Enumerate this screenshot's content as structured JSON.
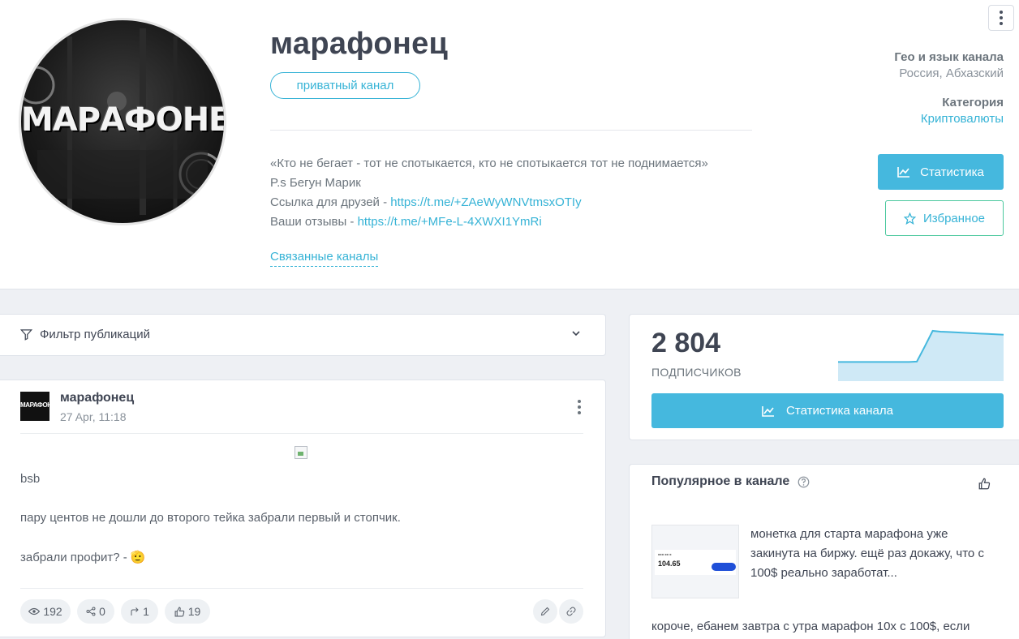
{
  "channel": {
    "title": "марафонец",
    "avatar_text": "МАРАФОНЕЦ",
    "tag": "приватный канал",
    "description": {
      "quote": "«Кто не бегает - тот не спотыкается, кто не спотыкается тот не поднимается»",
      "ps": "P.s Бегун Марик",
      "friends_label": "Ссылка для друзей - ",
      "friends_link": "https://t.me/+ZAeWyWNVtmsxOTIy",
      "reviews_label": "Ваши отзывы - ",
      "reviews_link": "https://t.me/+MFe-L-4XWXI1YmRi"
    },
    "related_link": "Связанные каналы",
    "geo_label": "Гео и язык канала",
    "geo_value": "Россия, Абхазский",
    "category_label": "Категория",
    "category_value": "Криптовалюты",
    "stats_button": "Статистика",
    "favorite_button": "Избранное"
  },
  "filter": {
    "label": "Фильтр публикаций"
  },
  "post": {
    "author": "марафонец",
    "avatar_text": "МАРАФОНЕЦ",
    "date": "27 Apr, 11:18",
    "lines": [
      "bsb",
      "пару центов не дошли до второго тейка забрали первый и стопчик.",
      "забрали профит? - 🫡"
    ],
    "views": "192",
    "shares": "0",
    "forwards": "1",
    "likes": "19"
  },
  "subscribers": {
    "count": "2 804",
    "label": "ПОДПИСЧИКОВ",
    "button": "Статистика канала",
    "trend": [
      20,
      20,
      20,
      20,
      20,
      20,
      20,
      20,
      20,
      20,
      21,
      60,
      100,
      98,
      97,
      96,
      95,
      94,
      93,
      92,
      91,
      90
    ]
  },
  "popular": {
    "title": "Популярное в канале",
    "item1_text": "монетка для старта марафона уже закинута на биржу. ещё раз докажу, что с 100$ реально заработат...",
    "item1_thumb_value": "104.65",
    "item2_text": "короче, ебанем завтра с утра марафон 10x с 100$, если"
  },
  "colors": {
    "accent": "#45b8de",
    "link": "#36b3d6",
    "favorite_border": "#4bc89e"
  }
}
